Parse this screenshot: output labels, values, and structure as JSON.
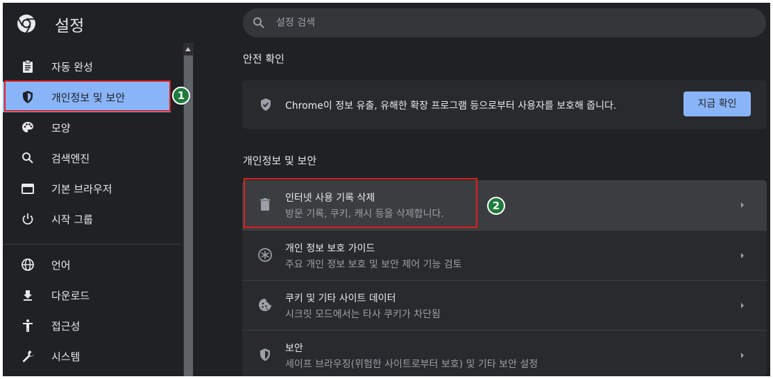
{
  "header": {
    "title": "설정",
    "search_placeholder": "설정 검색",
    "logo_icon": "chrome-logo-icon"
  },
  "sidebar": {
    "items": [
      {
        "label": "자동 완성",
        "icon": "clipboard-icon"
      },
      {
        "label": "개인정보 및 보안",
        "icon": "shield-icon",
        "active": true
      },
      {
        "label": "모양",
        "icon": "palette-icon"
      },
      {
        "label": "검색엔진",
        "icon": "search-icon"
      },
      {
        "label": "기본 브라우저",
        "icon": "browser-window-icon"
      },
      {
        "label": "시작 그룹",
        "icon": "power-icon"
      },
      {
        "label": "언어",
        "icon": "globe-icon"
      },
      {
        "label": "다운로드",
        "icon": "download-icon"
      },
      {
        "label": "접근성",
        "icon": "accessibility-icon"
      },
      {
        "label": "시스템",
        "icon": "wrench-icon"
      }
    ]
  },
  "annotations": {
    "badge1": "1",
    "badge2": "2"
  },
  "main": {
    "safety": {
      "heading": "안전 확인",
      "text": "Chrome이 정보 유출, 유해한 확장 프로그램 등으로부터 사용자를 보호해 줍니다.",
      "button": "지금 확인"
    },
    "privacy": {
      "heading": "개인정보 및 보안",
      "rows": [
        {
          "title": "인터넷 사용 기록 삭제",
          "sub": "방문 기록, 쿠키, 캐시 등을 삭제합니다.",
          "icon": "trash-icon"
        },
        {
          "title": "개인 정보 보호 가이드",
          "sub": "주요 개인 정보 보호 및 보안 제어 기능 검토",
          "icon": "privacy-guide-icon"
        },
        {
          "title": "쿠키 및 기타 사이트 데이터",
          "sub": "시크릿 모드에서는 타사 쿠키가 차단됨",
          "icon": "cookie-icon"
        },
        {
          "title": "보안",
          "sub": "세이프 브라우징(위험한 사이트로부터 보호) 및 기타 보안 설정",
          "icon": "security-shield-icon"
        }
      ]
    }
  },
  "colors": {
    "background": "#202124",
    "card": "#292a2d",
    "accent": "#8ab4f8",
    "annotation_red": "#e02020",
    "annotation_badge": "#1e7b3b"
  }
}
